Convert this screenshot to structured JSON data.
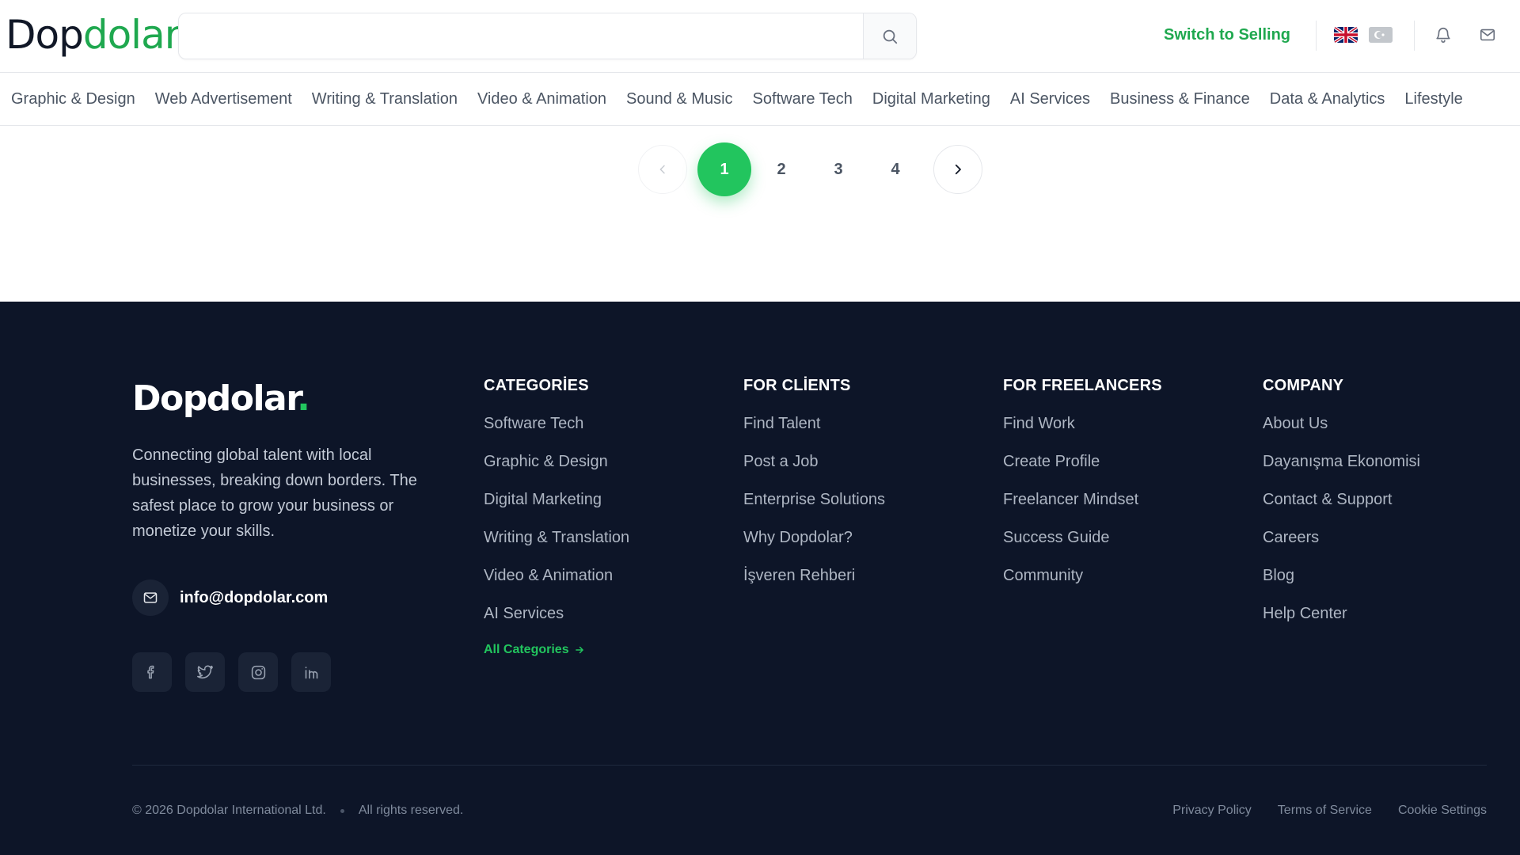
{
  "header": {
    "logo_part1": "Dop",
    "logo_part2": "dolar",
    "search_placeholder": "",
    "switch_label": "Switch to Selling",
    "icons": {
      "search": "search-icon",
      "notifications": "bell-icon",
      "messages": "mail-icon"
    },
    "flags": [
      "uk-flag-icon",
      "tr-flag-icon"
    ]
  },
  "category_nav": {
    "items": [
      "Graphic & Design",
      "Web Advertisement",
      "Writing & Translation",
      "Video & Animation",
      "Sound & Music",
      "Software Tech",
      "Digital Marketing",
      "AI Services",
      "Business & Finance",
      "Data & Analytics",
      "Lifestyle"
    ]
  },
  "pagination": {
    "pages": [
      "1",
      "2",
      "3",
      "4"
    ],
    "current": 1
  },
  "footer": {
    "logo": "Dopdolar",
    "logo_dot": ".",
    "description": "Connecting global talent with local businesses, breaking down borders. The safest place to grow your business or monetize your skills.",
    "email": "info@dopdolar.com",
    "social": [
      "facebook-icon",
      "twitter-icon",
      "instagram-icon",
      "linkedin-icon"
    ],
    "columns": {
      "categories": {
        "title": "CATEGORİES",
        "links": [
          "Software Tech",
          "Graphic & Design",
          "Digital Marketing",
          "Writing & Translation",
          "Video & Animation",
          "AI Services"
        ],
        "all_label": "All Categories"
      },
      "clients": {
        "title": "FOR CLİENTS",
        "links": [
          "Find Talent",
          "Post a Job",
          "Enterprise Solutions",
          "Why Dopdolar?",
          "İşveren Rehberi"
        ]
      },
      "freelancers": {
        "title": "FOR FREELANCERS",
        "links": [
          "Find Work",
          "Create Profile",
          "Freelancer Mindset",
          "Success Guide",
          "Community"
        ]
      },
      "company": {
        "title": "COMPANY",
        "links": [
          "About Us",
          "Dayanışma Ekonomisi",
          "Contact & Support",
          "Careers",
          "Blog",
          "Help Center"
        ]
      }
    },
    "copyright": "© 2026 Dopdolar International Ltd.",
    "rights": "All rights reserved.",
    "legal": [
      "Privacy Policy",
      "Terms of Service",
      "Cookie Settings"
    ]
  },
  "colors": {
    "brand_green": "#22c55e",
    "footer_bg": "#0d1528",
    "text_dark": "#111827"
  }
}
